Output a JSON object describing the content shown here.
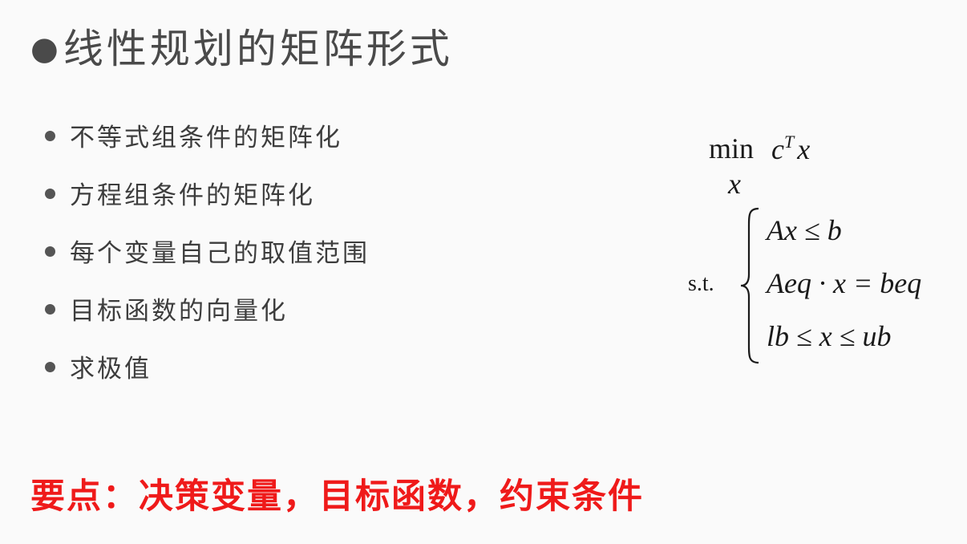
{
  "title": {
    "bullet": "●",
    "text": "线性规划的矩阵形式"
  },
  "bullets": [
    "不等式组条件的矩阵化",
    "方程组条件的矩阵化",
    "每个变量自己的取值范围",
    "目标函数的向量化",
    "求极值"
  ],
  "formula": {
    "min_word": "min",
    "objective": "c",
    "objective_sup": "T",
    "objective_var": "x",
    "min_var": "x",
    "st_label": "s.t.",
    "constraints": [
      "Ax ≤ b",
      "Aeq · x = beq",
      "lb ≤ x ≤ ub"
    ]
  },
  "key_point": "要点：决策变量，目标函数，约束条件",
  "colors": {
    "title": "#4a4a4a",
    "bullet_text": "#3d3d3d",
    "key_point": "#ef1a1a",
    "formula": "#1a1a1a"
  }
}
